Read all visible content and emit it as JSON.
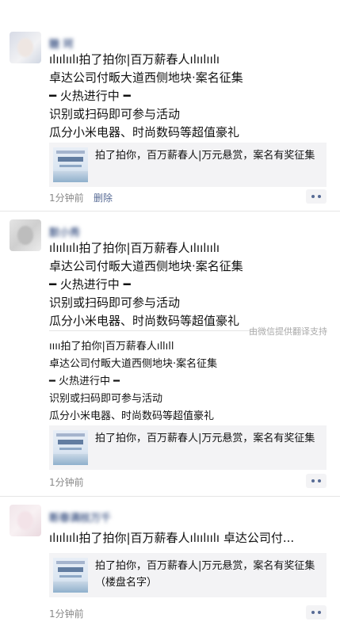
{
  "posts": [
    {
      "username": "糖 珂",
      "lines": [
        "ılıılıılı拍了拍你|百万薪春人ılıılıılı",
        "卓达公司付畈大道西侧地块·案名征集",
        "━ 火热进行中 ━",
        "识别或扫码即可参与活动",
        "瓜分小米电器、时尚数码等超值豪礼"
      ],
      "card_title": "拍了拍你，百万薪春人|万元悬赏，案名有奖征集",
      "time": "1分钟前",
      "delete_label": "删除"
    },
    {
      "username": "默小秀",
      "lines": [
        "ılıılıılı拍了拍你|百万薪春人ılıılıılı",
        "卓达公司付畈大道西侧地块·案名征集",
        "━ 火热进行中 ━",
        "识别或扫码即可参与活动",
        "瓜分小米电器、时尚数码等超值豪礼"
      ],
      "translate_note": "由微信提供翻译支持",
      "translated_lines": [
        "ıııı拍了拍你|百万薪春人ıllıll",
        "卓达公司付畈大道西侧地块·案名征集",
        "━ 火热进行中 ━",
        "识别或扫码即可参与活动",
        "瓜分小米电器、时尚数码等超值豪礼"
      ],
      "card_title": "拍了拍你，百万薪春人|万元悬赏，案名有奖征集",
      "time": "1分钟前"
    },
    {
      "username": "断春满枝万千",
      "lines": [
        "ılıılıılı拍了拍你|百万薪春人ılıılıılı 卓达公司付..."
      ],
      "card_title": "拍了拍你，百万薪春人|万元悬赏，案名有奖征集（楼盘名字）",
      "time": "1分钟前"
    }
  ],
  "icons": {
    "more": "more-dots-icon"
  },
  "colors": {
    "link": "#576b95",
    "meta": "#888888",
    "card_bg": "#f3f3f5"
  }
}
